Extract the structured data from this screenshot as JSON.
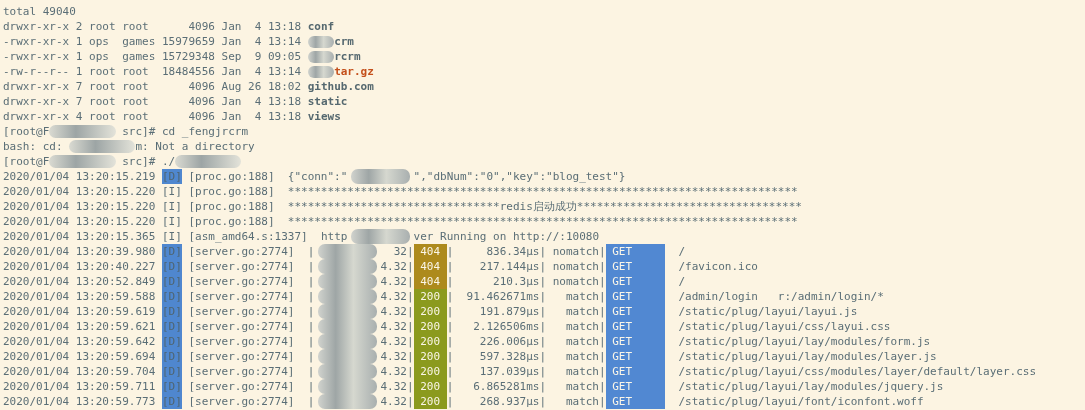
{
  "terminal": {
    "lines": [
      {
        "kind": "plain",
        "segments": [
          {
            "kind": "text",
            "text": "total 49040"
          }
        ]
      },
      {
        "kind": "ls",
        "mode": "drwxr-xr-x",
        "links": "2",
        "owner": "root",
        "group": "root",
        "size": "4096",
        "month": "Jan",
        "day": "4",
        "time": "13:18",
        "name": [
          {
            "kind": "text",
            "text": "conf",
            "color": "#55686f"
          }
        ]
      },
      {
        "kind": "ls",
        "mode": "-rwxr-xr-x",
        "links": "1",
        "owner": "ops",
        "group": "games",
        "size": "15979659",
        "month": "Jan",
        "day": "4",
        "time": "13:14",
        "name": [
          {
            "kind": "redaction"
          },
          {
            "kind": "text",
            "text": "crm",
            "color": "#55686f"
          }
        ]
      },
      {
        "kind": "ls",
        "mode": "-rwxr-xr-x",
        "links": "1",
        "owner": "ops",
        "group": "games",
        "size": "15729348",
        "month": "Sep",
        "day": "9",
        "time": "09:05",
        "name": [
          {
            "kind": "redaction"
          },
          {
            "kind": "text",
            "text": "rcrm",
            "color": "#55686f"
          }
        ]
      },
      {
        "kind": "ls",
        "mode": "-rw-r--r--",
        "links": "1",
        "owner": "root",
        "group": "root",
        "size": "18484556",
        "month": "Jan",
        "day": "4",
        "time": "13:14",
        "name": [
          {
            "kind": "redaction"
          },
          {
            "kind": "text",
            "text": "tar.gz",
            "color": "#c4501c"
          }
        ]
      },
      {
        "kind": "ls",
        "mode": "drwxr-xr-x",
        "links": "7",
        "owner": "root",
        "group": "root",
        "size": "4096",
        "month": "Aug",
        "day": "26",
        "time": "18:02",
        "name": [
          {
            "kind": "text",
            "text": "github.com",
            "color": "#55686f"
          }
        ]
      },
      {
        "kind": "ls",
        "mode": "drwxr-xr-x",
        "links": "7",
        "owner": "root",
        "group": "root",
        "size": "4096",
        "month": "Jan",
        "day": "4",
        "time": "13:18",
        "name": [
          {
            "kind": "text",
            "text": "static",
            "color": "#55686f"
          }
        ]
      },
      {
        "kind": "ls",
        "mode": "drwxr-xr-x",
        "links": "4",
        "owner": "root",
        "group": "root",
        "size": "4096",
        "month": "Jan",
        "day": "4",
        "time": "13:18",
        "name": [
          {
            "kind": "text",
            "text": "views",
            "color": "#55686f"
          }
        ]
      },
      {
        "kind": "plain",
        "segments": [
          {
            "kind": "text",
            "text": "[root@F"
          },
          {
            "kind": "redaction"
          },
          {
            "kind": "text",
            "text": " src]# cd _fengjrcrm"
          }
        ]
      },
      {
        "kind": "plain",
        "segments": [
          {
            "kind": "text",
            "text": "bash: cd: "
          },
          {
            "kind": "redaction"
          },
          {
            "kind": "text",
            "text": "m: Not a directory"
          }
        ]
      },
      {
        "kind": "plain",
        "segments": [
          {
            "kind": "text",
            "text": "[root@F"
          },
          {
            "kind": "redaction"
          },
          {
            "kind": "text",
            "text": " src]# ./"
          },
          {
            "kind": "redaction"
          }
        ]
      },
      {
        "kind": "log",
        "time": "2020/01/04 13:20:15.219",
        "level": "[D]",
        "highlighted": true,
        "source": "[proc.go:188]",
        "segments": [
          {
            "kind": "text",
            "text": "  {\"conn\":\""
          },
          {
            "kind": "redaction"
          },
          {
            "kind": "text",
            "text": "\",\"dbNum\":\"0\",\"key\":\"blog_test\"}"
          }
        ]
      },
      {
        "kind": "log",
        "time": "2020/01/04 13:20:15.220",
        "level": "[I]",
        "highlighted": false,
        "source": "[proc.go:188]",
        "segments": [
          {
            "kind": "text",
            "text": "  *****************************************************************************"
          }
        ]
      },
      {
        "kind": "log",
        "time": "2020/01/04 13:20:15.220",
        "level": "[I]",
        "highlighted": false,
        "source": "[proc.go:188]",
        "segments": [
          {
            "kind": "text",
            "text": "  ********************************redis启动成功**********************************"
          }
        ]
      },
      {
        "kind": "log",
        "time": "2020/01/04 13:20:15.220",
        "level": "[I]",
        "highlighted": false,
        "source": "[proc.go:188]",
        "segments": [
          {
            "kind": "text",
            "text": "  *****************************************************************************"
          }
        ]
      },
      {
        "kind": "log",
        "time": "2020/01/04 13:20:15.365",
        "level": "[I]",
        "highlighted": false,
        "source": "[asm_amd64.s:1337]",
        "segments": [
          {
            "kind": "text",
            "text": "  http"
          },
          {
            "kind": "redaction"
          },
          {
            "kind": "text",
            "text": "ver Running on http://:10080"
          }
        ]
      },
      {
        "kind": "log",
        "time": "2020/01/04 13:20:39.980",
        "level": "[D]",
        "highlighted": true,
        "source": "[server.go:2774]",
        "segments": [
          {
            "kind": "text",
            "text": "  |"
          },
          {
            "kind": "redaction"
          },
          {
            "kind": "text",
            "text": "  32|"
          },
          {
            "kind": "status",
            "text": "404",
            "color": "#ad8a1c"
          },
          {
            "kind": "text",
            "text": "|     836.34µs|"
          },
          {
            "kind": "text",
            "text": " nomatch|"
          },
          {
            "kind": "method",
            "text": "GET"
          },
          {
            "kind": "text",
            "text": "  /"
          }
        ]
      },
      {
        "kind": "log",
        "time": "2020/01/04 13:20:40.227",
        "level": "[D]",
        "highlighted": true,
        "source": "[server.go:2774]",
        "segments": [
          {
            "kind": "text",
            "text": "  |"
          },
          {
            "kind": "redaction"
          },
          {
            "kind": "text",
            "text": "4.32|"
          },
          {
            "kind": "status",
            "text": "404",
            "color": "#ad8a1c"
          },
          {
            "kind": "text",
            "text": "|    217.144µs|"
          },
          {
            "kind": "text",
            "text": " nomatch|"
          },
          {
            "kind": "method",
            "text": "GET"
          },
          {
            "kind": "text",
            "text": "  /favicon.ico"
          }
        ]
      },
      {
        "kind": "log",
        "time": "2020/01/04 13:20:52.849",
        "level": "[D]",
        "highlighted": true,
        "source": "[server.go:2774]",
        "segments": [
          {
            "kind": "text",
            "text": "  |"
          },
          {
            "kind": "redaction"
          },
          {
            "kind": "text",
            "text": "4.32|"
          },
          {
            "kind": "status",
            "text": "404",
            "color": "#ad8a1c"
          },
          {
            "kind": "text",
            "text": "|      210.3µs|"
          },
          {
            "kind": "text",
            "text": " nomatch|"
          },
          {
            "kind": "method",
            "text": "GET"
          },
          {
            "kind": "text",
            "text": "  /"
          }
        ]
      },
      {
        "kind": "log",
        "time": "2020/01/04 13:20:59.588",
        "level": "[D]",
        "highlighted": true,
        "source": "[server.go:2774]",
        "segments": [
          {
            "kind": "text",
            "text": "  |"
          },
          {
            "kind": "redaction"
          },
          {
            "kind": "text",
            "text": "4.32|"
          },
          {
            "kind": "status",
            "text": "200",
            "color": "#8b9a1e"
          },
          {
            "kind": "text",
            "text": "|  91.462671ms|"
          },
          {
            "kind": "text",
            "text": "   match|"
          },
          {
            "kind": "method",
            "text": "GET"
          },
          {
            "kind": "text",
            "text": "  /admin/login   r:/admin/login/*"
          }
        ]
      },
      {
        "kind": "log",
        "time": "2020/01/04 13:20:59.619",
        "level": "[D]",
        "highlighted": true,
        "source": "[server.go:2774]",
        "segments": [
          {
            "kind": "text",
            "text": "  |"
          },
          {
            "kind": "redaction"
          },
          {
            "kind": "text",
            "text": "4.32|"
          },
          {
            "kind": "status",
            "text": "200",
            "color": "#8b9a1e"
          },
          {
            "kind": "text",
            "text": "|    191.879µs|"
          },
          {
            "kind": "text",
            "text": "   match|"
          },
          {
            "kind": "method",
            "text": "GET"
          },
          {
            "kind": "text",
            "text": "  /static/plug/layui/layui.js"
          }
        ]
      },
      {
        "kind": "log",
        "time": "2020/01/04 13:20:59.621",
        "level": "[D]",
        "highlighted": true,
        "source": "[server.go:2774]",
        "segments": [
          {
            "kind": "text",
            "text": "  |"
          },
          {
            "kind": "redaction"
          },
          {
            "kind": "text",
            "text": "4.32|"
          },
          {
            "kind": "status",
            "text": "200",
            "color": "#8b9a1e"
          },
          {
            "kind": "text",
            "text": "|   2.126506ms|"
          },
          {
            "kind": "text",
            "text": "   match|"
          },
          {
            "kind": "method",
            "text": "GET"
          },
          {
            "kind": "text",
            "text": "  /static/plug/layui/css/layui.css"
          }
        ]
      },
      {
        "kind": "log",
        "time": "2020/01/04 13:20:59.642",
        "level": "[D]",
        "highlighted": true,
        "source": "[server.go:2774]",
        "segments": [
          {
            "kind": "text",
            "text": "  |"
          },
          {
            "kind": "redaction"
          },
          {
            "kind": "text",
            "text": "4.32|"
          },
          {
            "kind": "status",
            "text": "200",
            "color": "#8b9a1e"
          },
          {
            "kind": "text",
            "text": "|    226.006µs|"
          },
          {
            "kind": "text",
            "text": "   match|"
          },
          {
            "kind": "method",
            "text": "GET"
          },
          {
            "kind": "text",
            "text": "  /static/plug/layui/lay/modules/form.js"
          }
        ]
      },
      {
        "kind": "log",
        "time": "2020/01/04 13:20:59.694",
        "level": "[D]",
        "highlighted": true,
        "source": "[server.go:2774]",
        "segments": [
          {
            "kind": "text",
            "text": "  |"
          },
          {
            "kind": "redaction"
          },
          {
            "kind": "text",
            "text": "4.32|"
          },
          {
            "kind": "status",
            "text": "200",
            "color": "#8b9a1e"
          },
          {
            "kind": "text",
            "text": "|    597.328µs|"
          },
          {
            "kind": "text",
            "text": "   match|"
          },
          {
            "kind": "method",
            "text": "GET"
          },
          {
            "kind": "text",
            "text": "  /static/plug/layui/lay/modules/layer.js"
          }
        ]
      },
      {
        "kind": "log",
        "time": "2020/01/04 13:20:59.704",
        "level": "[D]",
        "highlighted": true,
        "source": "[server.go:2774]",
        "segments": [
          {
            "kind": "text",
            "text": "  |"
          },
          {
            "kind": "redaction"
          },
          {
            "kind": "text",
            "text": "4.32|"
          },
          {
            "kind": "status",
            "text": "200",
            "color": "#8b9a1e"
          },
          {
            "kind": "text",
            "text": "|    137.039µs|"
          },
          {
            "kind": "text",
            "text": "   match|"
          },
          {
            "kind": "method",
            "text": "GET"
          },
          {
            "kind": "text",
            "text": "  /static/plug/layui/css/modules/layer/default/layer.css"
          }
        ]
      },
      {
        "kind": "log",
        "time": "2020/01/04 13:20:59.711",
        "level": "[D]",
        "highlighted": true,
        "source": "[server.go:2774]",
        "segments": [
          {
            "kind": "text",
            "text": "  |"
          },
          {
            "kind": "redaction"
          },
          {
            "kind": "text",
            "text": "4.32|"
          },
          {
            "kind": "status",
            "text": "200",
            "color": "#8b9a1e"
          },
          {
            "kind": "text",
            "text": "|   6.865281ms|"
          },
          {
            "kind": "text",
            "text": "   match|"
          },
          {
            "kind": "method",
            "text": "GET"
          },
          {
            "kind": "text",
            "text": "  /static/plug/layui/lay/modules/jquery.js"
          }
        ]
      },
      {
        "kind": "log",
        "time": "2020/01/04 13:20:59.773",
        "level": "[D]",
        "highlighted": true,
        "source": "[server.go:2774]",
        "segments": [
          {
            "kind": "text",
            "text": "  |"
          },
          {
            "kind": "redaction"
          },
          {
            "kind": "text",
            "text": "4.32|"
          },
          {
            "kind": "status",
            "text": "200",
            "color": "#8b9a1e"
          },
          {
            "kind": "text",
            "text": "|    268.937µs|"
          },
          {
            "kind": "text",
            "text": "   match|"
          },
          {
            "kind": "method",
            "text": "GET"
          },
          {
            "kind": "text",
            "text": "  /static/plug/layui/font/iconfont.woff"
          }
        ]
      }
    ]
  }
}
